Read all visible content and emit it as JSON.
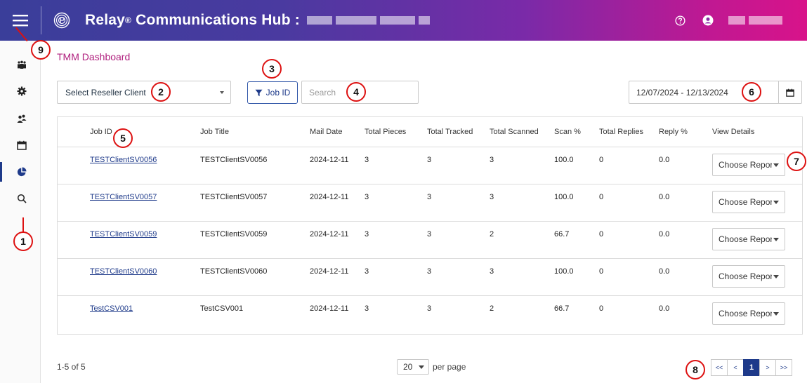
{
  "header": {
    "brand": "Relay",
    "registered": "®",
    "title_suffix": " Communications Hub : ",
    "gradient": [
      "#3a3e9a",
      "#d8138a"
    ],
    "icons": [
      "menu-icon",
      "relay-logo-icon",
      "help-icon",
      "user-profile-icon"
    ]
  },
  "sidebar": {
    "items": [
      {
        "name": "clients-icon"
      },
      {
        "name": "settings-icon"
      },
      {
        "name": "users-icon"
      },
      {
        "name": "calendar-icon"
      },
      {
        "name": "pie-chart-icon",
        "active": true
      },
      {
        "name": "search-icon"
      }
    ]
  },
  "breadcrumb": "TMM Dashboard",
  "filters": {
    "reseller_select": "Select Reseller Client",
    "job_id_button": "Job ID",
    "search_placeholder": "Search",
    "date_range": "12/07/2024 - 12/13/2024"
  },
  "table": {
    "headers": [
      "Job ID",
      "Job Title",
      "Mail Date",
      "Total Pieces",
      "Total Tracked",
      "Total Scanned",
      "Scan %",
      "Total Replies",
      "Reply %",
      "View Details"
    ],
    "report_label": "Choose Report",
    "rows": [
      {
        "job_id": "TESTClientSV0056",
        "job_title": "TESTClientSV0056",
        "mail_date": "2024-12-11",
        "pieces": "3",
        "tracked": "3",
        "scanned": "3",
        "scan_pct": "100.0",
        "replies": "0",
        "reply_pct": "0.0"
      },
      {
        "job_id": "TESTClientSV0057",
        "job_title": "TESTClientSV0057",
        "mail_date": "2024-12-11",
        "pieces": "3",
        "tracked": "3",
        "scanned": "3",
        "scan_pct": "100.0",
        "replies": "0",
        "reply_pct": "0.0"
      },
      {
        "job_id": "TESTClientSV0059",
        "job_title": "TESTClientSV0059",
        "mail_date": "2024-12-11",
        "pieces": "3",
        "tracked": "3",
        "scanned": "2",
        "scan_pct": "66.7",
        "replies": "0",
        "reply_pct": "0.0"
      },
      {
        "job_id": "TESTClientSV0060",
        "job_title": "TESTClientSV0060",
        "mail_date": "2024-12-11",
        "pieces": "3",
        "tracked": "3",
        "scanned": "3",
        "scan_pct": "100.0",
        "replies": "0",
        "reply_pct": "0.0"
      },
      {
        "job_id": "TestCSV001",
        "job_title": "TestCSV001",
        "mail_date": "2024-12-11",
        "pieces": "3",
        "tracked": "3",
        "scanned": "2",
        "scan_pct": "66.7",
        "replies": "0",
        "reply_pct": "0.0"
      }
    ]
  },
  "footer": {
    "count": "1-5 of 5",
    "per_page_value": "20",
    "per_page_label": "per page",
    "pager": [
      "<<",
      "<",
      "1",
      ">",
      ">>"
    ],
    "current_page": "1"
  },
  "callouts": [
    "1",
    "2",
    "3",
    "4",
    "5",
    "6",
    "7",
    "8",
    "9"
  ],
  "colors": {
    "accent": "#1e3a8a",
    "breadcrumb": "#b0207e",
    "callout": "#dd1111"
  }
}
